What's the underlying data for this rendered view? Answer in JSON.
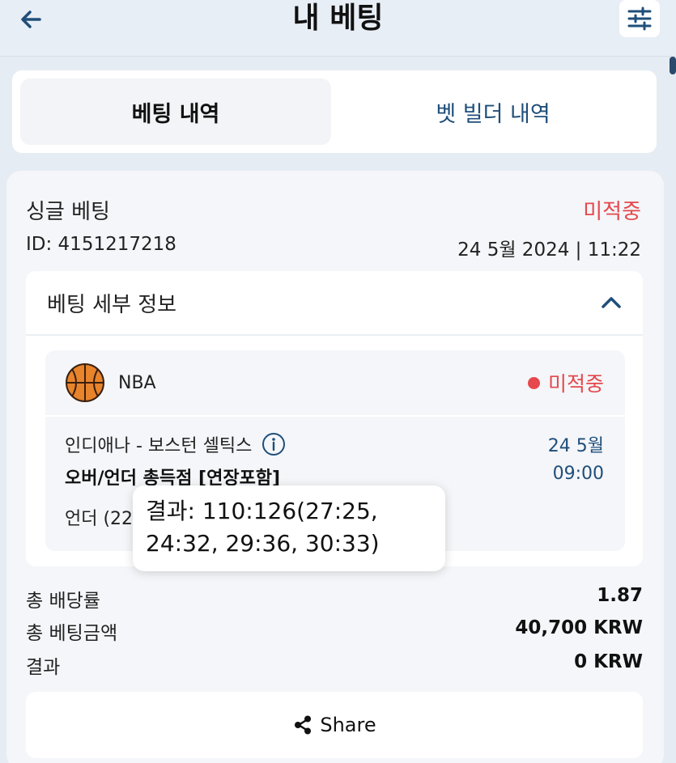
{
  "header": {
    "title": "내 베팅",
    "back_icon": "arrow-left-icon",
    "filter_icon": "sliders-icon"
  },
  "tabs": [
    {
      "label": "베팅 내역",
      "active": true
    },
    {
      "label": "벳 빌더 내역",
      "active": false
    }
  ],
  "bet": {
    "type": "싱글 베팅",
    "status": "미적중",
    "id": "ID: 4151217218",
    "datetime": "24 5월 2024 | 11:22",
    "details": {
      "title": "베팅 세부 정보",
      "event": {
        "league": "NBA",
        "status": "미적중",
        "match": "인디애나 - 보스턴 셀틱스",
        "date": "24 5월",
        "time": "09:00",
        "market": "오버/언더 총득점 [연장포함]",
        "selection": "언더 (22"
      }
    },
    "summary": {
      "odds_label": "총 배당률",
      "odds_value": "1.87",
      "stake_label": "총 베팅금액",
      "stake_value": "40,700 KRW",
      "result_label": "결과",
      "result_value": "0 KRW"
    },
    "share_label": "Share"
  },
  "tooltip": {
    "line1": "결과: 110:126(27:25,",
    "line2": "24:32, 29:36, 30:33)"
  },
  "colors": {
    "accent": "#1f4e7a",
    "loss": "#e5484d",
    "background": "#e6ecf3",
    "ball": "#e8842b"
  }
}
